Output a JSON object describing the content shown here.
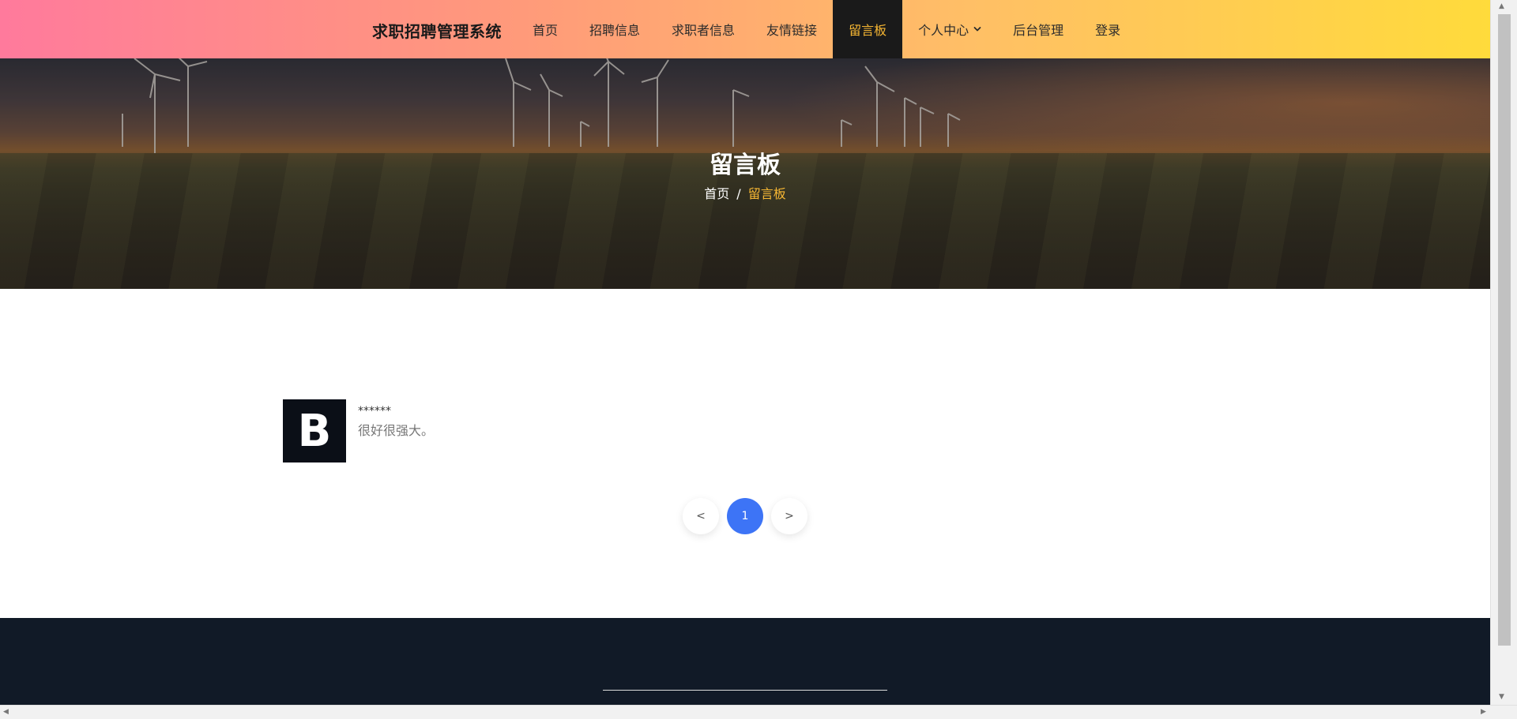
{
  "header": {
    "brand": "求职招聘管理系统",
    "nav": [
      {
        "label": "首页",
        "active": false
      },
      {
        "label": "招聘信息",
        "active": false
      },
      {
        "label": "求职者信息",
        "active": false
      },
      {
        "label": "友情链接",
        "active": false
      },
      {
        "label": "留言板",
        "active": true
      },
      {
        "label": "个人中心",
        "active": false,
        "dropdown": true
      },
      {
        "label": "后台管理",
        "active": false
      },
      {
        "label": "登录",
        "active": false
      }
    ]
  },
  "hero": {
    "title": "留言板",
    "breadcrumb": {
      "home": "首页",
      "separator": "/",
      "current": "留言板"
    }
  },
  "messages": [
    {
      "avatar_letter": "B",
      "user": "******",
      "text": "很好很强大。"
    }
  ],
  "pagination": {
    "prev": "<",
    "current": "1",
    "next": ">"
  },
  "colors": {
    "nav_gradient_start": "#ff7a9c",
    "nav_gradient_end": "#ffdb3b",
    "active_nav_bg": "#1a1a1a",
    "active_nav_text": "#f7b733",
    "breadcrumb_current": "#f7b733",
    "page_active": "#3d74f6",
    "footer_bg": "#111a27",
    "avatar_bg": "#0b0f17"
  },
  "icons": {
    "dropdown": "chevron-down-icon"
  }
}
